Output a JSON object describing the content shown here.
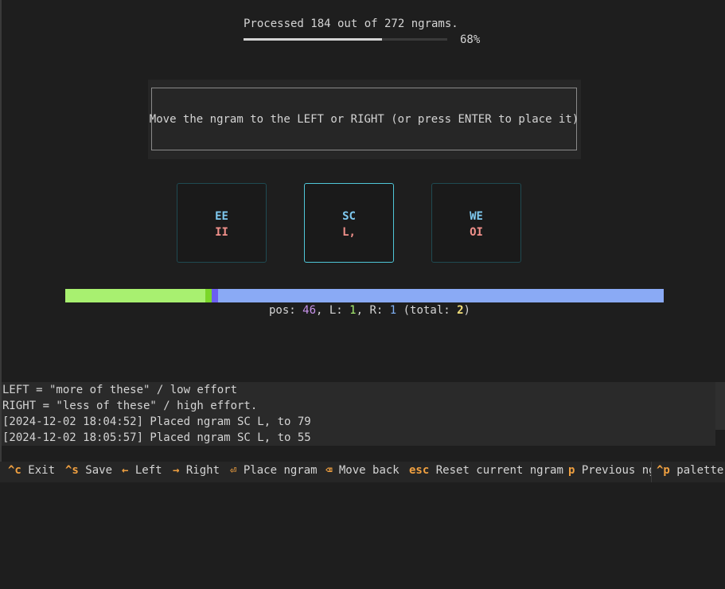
{
  "progress": {
    "text": "Processed 184 out of 272 ngrams.",
    "percent_label": "68%",
    "fraction": 0.68
  },
  "instruction": "Move the ngram to the LEFT or RIGHT (or press ENTER to place it)",
  "cards": [
    {
      "top": "EE",
      "bottom": "II",
      "active": false
    },
    {
      "top": "SC",
      "bottom": "L,",
      "active": true
    },
    {
      "top": "WE",
      "bottom": "OI",
      "active": false
    }
  ],
  "position_status": {
    "pos_label": "pos: ",
    "pos_value": "46",
    "l_label": ", L: ",
    "l_value": "1",
    "r_label": ", R: ",
    "r_value": "1",
    "total_label": " (total: ",
    "total_value": "2",
    "close": ")"
  },
  "log": [
    "LEFT = \"more of these\" / low effort",
    "RIGHT = \"less of these\" / high effort.",
    "[2024-12-02 18:04:52] Placed ngram SC L, to 79",
    "[2024-12-02 18:05:57] Placed ngram SC L, to 55"
  ],
  "footer": {
    "items": [
      {
        "key": "^c",
        "label": "Exit"
      },
      {
        "key": "^s",
        "label": "Save"
      },
      {
        "key": "←",
        "label": "Left"
      },
      {
        "key": "→",
        "label": "Right"
      },
      {
        "key": "⏎",
        "label": "Place ngram"
      },
      {
        "key": "⌫",
        "label": "Move back"
      },
      {
        "key": "esc",
        "label": "Reset current ngram"
      },
      {
        "key": "p",
        "label": "Previous ng"
      }
    ],
    "palette_key": "^p",
    "palette_label": "palette"
  },
  "colors": {
    "left_segment": "#a8f070",
    "right_segment": "#8aaaf5",
    "key_accent": "#f0a040",
    "card_active_border": "#4fc6d8"
  }
}
